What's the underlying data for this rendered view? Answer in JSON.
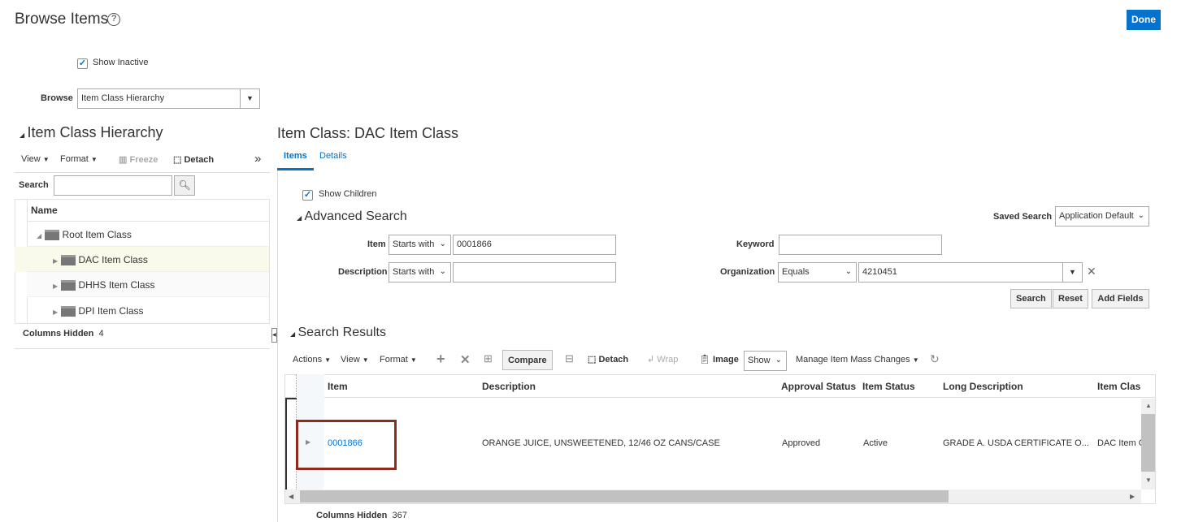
{
  "header": {
    "title": "Browse Items",
    "done_label": "Done"
  },
  "show_inactive": {
    "label": "Show Inactive",
    "checked": true
  },
  "browse": {
    "label": "Browse",
    "value": "Item Class Hierarchy"
  },
  "hierarchy": {
    "title": "Item Class Hierarchy",
    "toolbar": {
      "view": "View",
      "format": "Format",
      "freeze": "Freeze",
      "detach": "Detach"
    },
    "search_label": "Search",
    "column_name": "Name",
    "nodes": [
      "Root Item Class",
      "DAC Item Class",
      "DHHS Item Class",
      "DPI Item Class"
    ],
    "columns_hidden_label": "Columns Hidden",
    "columns_hidden_count": "4"
  },
  "main": {
    "title": "Item Class: DAC Item Class",
    "tabs": [
      "Items",
      "Details"
    ],
    "show_children": {
      "label": "Show Children",
      "checked": true
    },
    "advanced_search": {
      "title": "Advanced Search",
      "saved_search_label": "Saved Search",
      "saved_search_value": "Application Default",
      "item_label": "Item",
      "item_op": "Starts with",
      "item_value": "0001866",
      "description_label": "Description",
      "description_op": "Starts with",
      "description_value": "",
      "keyword_label": "Keyword",
      "keyword_value": "",
      "organization_label": "Organization",
      "organization_op": "Equals",
      "organization_value": "4210451",
      "search_btn": "Search",
      "reset_btn": "Reset",
      "add_fields_btn": "Add Fields"
    },
    "results": {
      "title": "Search Results",
      "toolbar": {
        "actions": "Actions",
        "view": "View",
        "format": "Format",
        "compare": "Compare",
        "detach": "Detach",
        "wrap": "Wrap",
        "image": "Image",
        "show": "Show",
        "manage": "Manage Item Mass Changes"
      },
      "columns": [
        "Item",
        "Description",
        "Approval Status",
        "Item Status",
        "Long Description",
        "Item Class"
      ],
      "rows": [
        {
          "item": "0001866",
          "description": "ORANGE JUICE, UNSWEETENED, 12/46 OZ CANS/CASE",
          "approval_status": "Approved",
          "item_status": "Active",
          "long_description": "GRADE A. USDA CERTIFICATE O...",
          "item_class": "DAC Item C"
        }
      ],
      "columns_hidden_label": "Columns Hidden",
      "columns_hidden_count": "367"
    }
  }
}
